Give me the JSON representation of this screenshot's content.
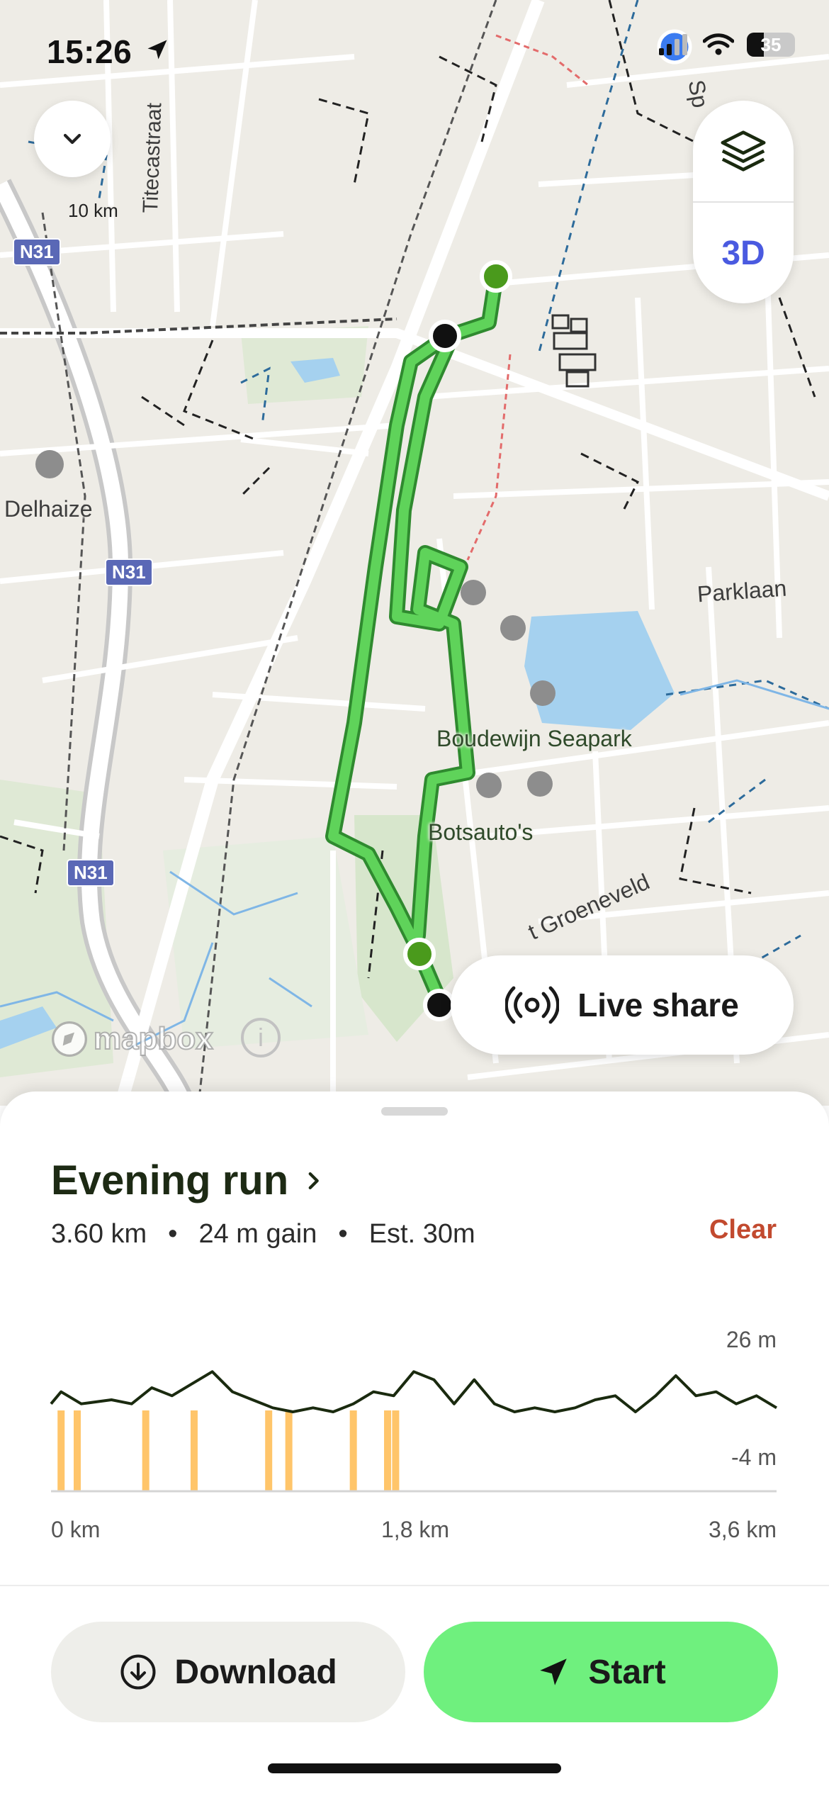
{
  "status_bar": {
    "time": "15:26",
    "battery": "35"
  },
  "map": {
    "scale_label": "10 km",
    "street_labels": [
      "Titecastraat",
      "Delhaize",
      "Parklaan",
      "Boudewijn Seapark",
      "Botsauto's",
      "t Groeneveld",
      "Sp"
    ],
    "road_shields": [
      "N31",
      "N31",
      "N31"
    ],
    "layers_icon": "layers-icon",
    "three_d_label": "3D",
    "attribution": "mapbox",
    "live_share_label": "Live share"
  },
  "route": {
    "title": "Evening run",
    "distance": "3.60 km",
    "gain": "24 m gain",
    "estimate": "Est. 30m",
    "clear_label": "Clear"
  },
  "chart_data": {
    "type": "line",
    "xlabel": "",
    "ylabel": "",
    "x_ticks": [
      "0 km",
      "1,8 km",
      "3,6 km"
    ],
    "y_ticks": [
      "26 m",
      "-4 m"
    ],
    "xlim": [
      0,
      3.6
    ],
    "ylim": [
      -4,
      26
    ],
    "x": [
      0.0,
      0.05,
      0.15,
      0.3,
      0.4,
      0.5,
      0.6,
      0.7,
      0.8,
      0.9,
      1.0,
      1.1,
      1.2,
      1.3,
      1.4,
      1.5,
      1.6,
      1.7,
      1.8,
      1.9,
      2.0,
      2.1,
      2.2,
      2.3,
      2.4,
      2.5,
      2.6,
      2.7,
      2.8,
      2.9,
      3.0,
      3.1,
      3.2,
      3.3,
      3.4,
      3.5,
      3.6
    ],
    "y": [
      10,
      13,
      10,
      11,
      10,
      14,
      12,
      15,
      18,
      13,
      11,
      9,
      8,
      9,
      8,
      10,
      13,
      12,
      18,
      16,
      10,
      16,
      10,
      8,
      9,
      8,
      9,
      11,
      12,
      8,
      12,
      17,
      12,
      13,
      10,
      12,
      9
    ],
    "highlight_x": [
      0.05,
      0.13,
      0.47,
      0.71,
      1.08,
      1.18,
      1.5,
      1.67,
      1.71
    ],
    "line_color": "#1a2a0f",
    "highlight_color": "#ffc56a"
  },
  "footer": {
    "download_label": "Download",
    "start_label": "Start"
  },
  "colors": {
    "route_green": "#5fd35a",
    "start_marker": "#4a9a1c",
    "start_button": "#6ff07e",
    "clear_text": "#c24a2f",
    "three_d_text": "#4a5ae0"
  }
}
